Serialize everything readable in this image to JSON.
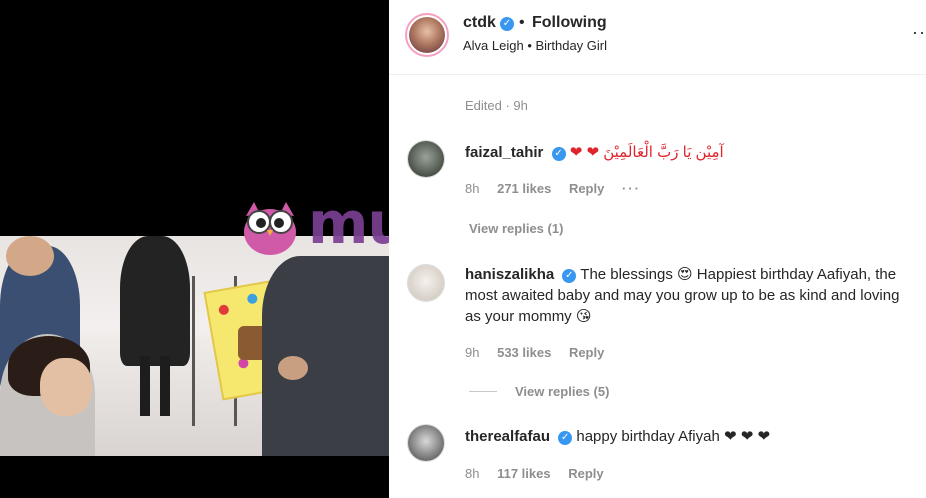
{
  "post": {
    "username": "ctdk",
    "separator": "•",
    "follow_status": "Following",
    "subtitle": "Alva Leigh • Birthday Girl",
    "edited": "Edited · 9h",
    "more_glyph": "··"
  },
  "watermark": {
    "text": "murai"
  },
  "comments": [
    {
      "username": "faizal_tahir",
      "text": "❤ ❤ آمِيْن يَا رَبَّ الْعَالَمِيْنَ",
      "time": "8h",
      "likes": "271 likes",
      "reply": "Reply",
      "options": "···",
      "view_replies": "View replies (1)"
    },
    {
      "username": "haniszalikha",
      "text": "The blessings 😍 Happiest birthday Aafiyah, the most awaited baby and may you grow up to be as kind and loving as your mommy 😘",
      "time": "9h",
      "likes": "533 likes",
      "reply": "Reply",
      "view_replies": "View replies (5)"
    },
    {
      "username": "therealfafau",
      "text": "happy birthday Afiyah ❤ ❤ ❤",
      "time": "8h",
      "likes": "117 likes",
      "reply": "Reply"
    }
  ],
  "colors": {
    "verified": "#3897f0",
    "watermark": "#7b3f93",
    "muted": "#8e8e8e",
    "heart": "#e0242d"
  },
  "icons": [
    "verified-badge-icon",
    "more-options-icon",
    "owl-logo-icon"
  ]
}
